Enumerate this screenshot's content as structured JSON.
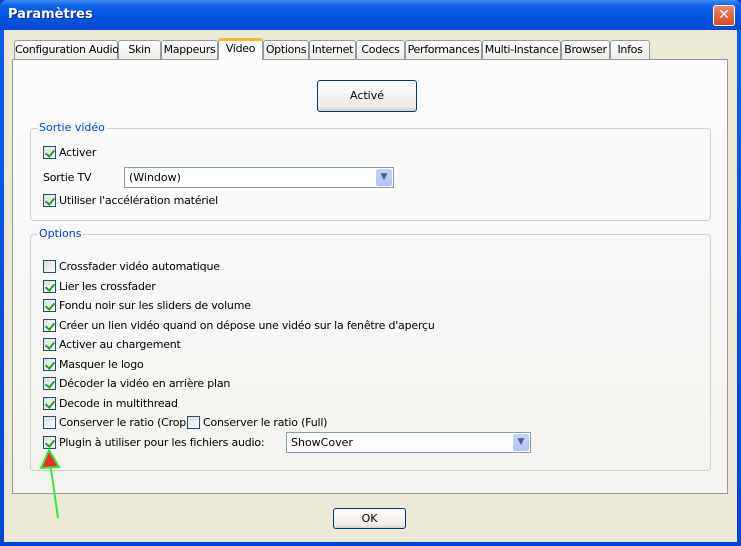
{
  "window": {
    "title": "Paramètres",
    "close_icon": "close-icon"
  },
  "tabs": [
    {
      "label": "Configuration Audio"
    },
    {
      "label": "Skin"
    },
    {
      "label": "Mappeurs"
    },
    {
      "label": "Video",
      "active": true
    },
    {
      "label": "Options"
    },
    {
      "label": "Internet"
    },
    {
      "label": "Codecs"
    },
    {
      "label": "Performances"
    },
    {
      "label": "Multi-Instance"
    },
    {
      "label": "Browser"
    },
    {
      "label": "Infos"
    }
  ],
  "status_button": "Activé",
  "sortie_video": {
    "title": "Sortie vidéo",
    "activer": {
      "label": "Activer",
      "checked": true
    },
    "sortie_tv_label": "Sortie TV",
    "sortie_tv_value": "(Window)",
    "acceleration": {
      "label": "Utiliser l'accélération matériel",
      "checked": true
    }
  },
  "options": {
    "title": "Options",
    "items": [
      {
        "label": "Crossfader vidéo automatique",
        "checked": false
      },
      {
        "label": "Lier les crossfader",
        "checked": true
      },
      {
        "label": "Fondu noir sur les sliders de volume",
        "checked": true
      },
      {
        "label": "Créer un lien vidéo quand on dépose une vidéo sur la fenêtre d'aperçu",
        "checked": true
      },
      {
        "label": "Activer au chargement",
        "checked": true
      },
      {
        "label": "Masquer le logo",
        "checked": true
      },
      {
        "label": "Décoder la vidéo en arrière plan",
        "checked": true
      },
      {
        "label": "Decode in multithread",
        "checked": true
      },
      {
        "label": "Conserver le ratio (Crop)",
        "checked": false
      },
      {
        "label": "Conserver le ratio (Full)",
        "checked": false
      },
      {
        "label": "Plugin à utiliser pour les fichiers audio:",
        "checked": true
      }
    ],
    "plugin_value": "ShowCover"
  },
  "ok_button": "OK",
  "annotation": {
    "arrow_colors": {
      "head": "#e8302a",
      "shaft": "#39e639"
    }
  }
}
